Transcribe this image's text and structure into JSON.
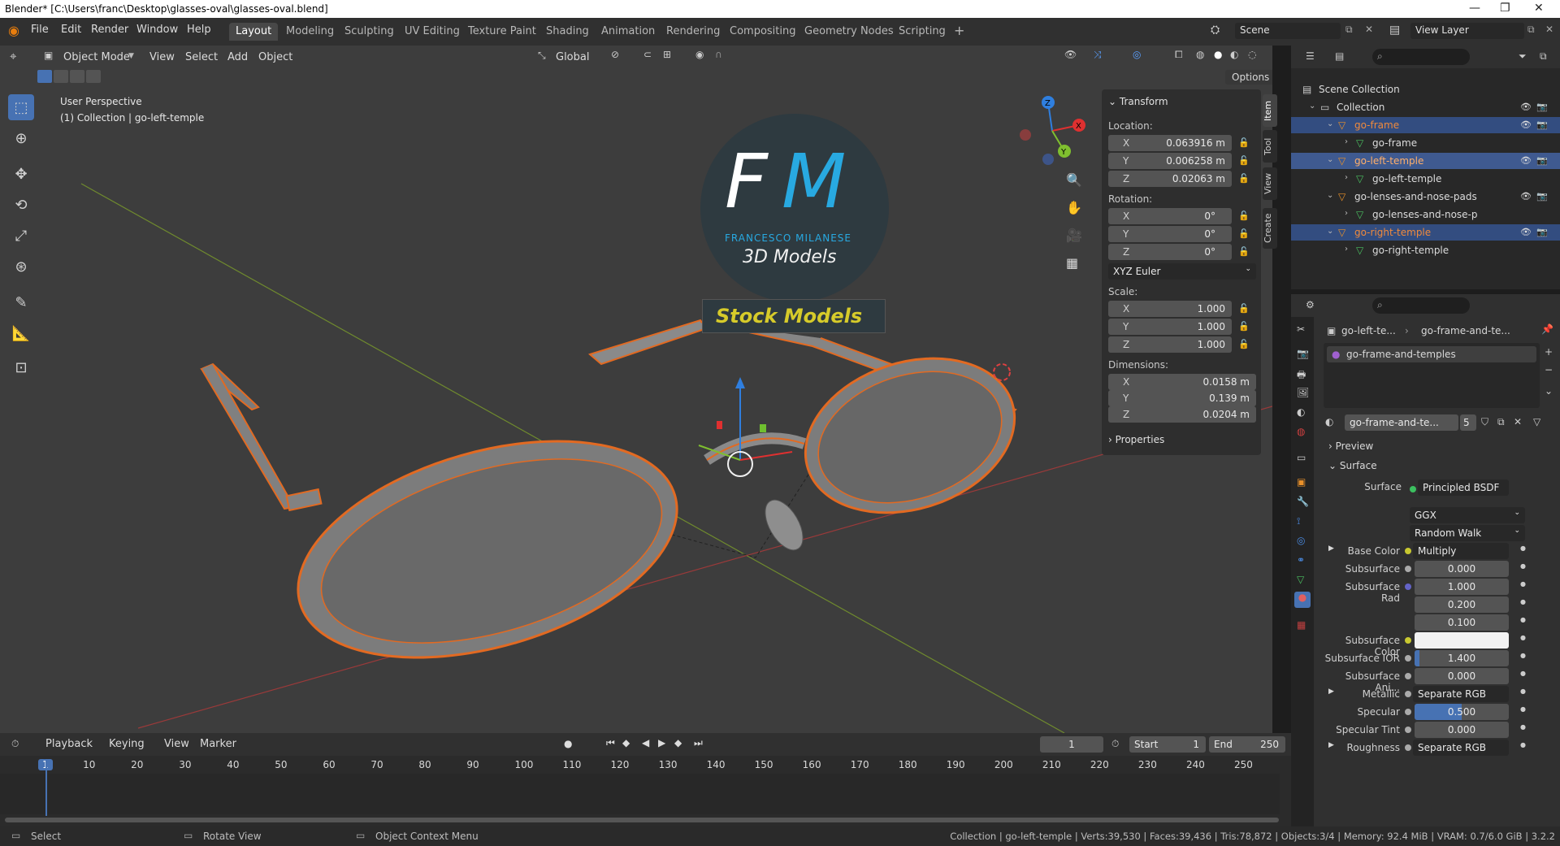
{
  "window": {
    "title": "Blender* [C:\\Users\\franc\\Desktop\\glasses-oval\\glasses-oval.blend]",
    "controls": [
      "—",
      "❐",
      "✕"
    ]
  },
  "menu": [
    "File",
    "Edit",
    "Render",
    "Window",
    "Help"
  ],
  "workspaces": [
    "Layout",
    "Modeling",
    "Sculpting",
    "UV Editing",
    "Texture Paint",
    "Shading",
    "Animation",
    "Rendering",
    "Compositing",
    "Geometry Nodes",
    "Scripting",
    "+"
  ],
  "scene": {
    "label": "Scene",
    "view_layer": "View Layer"
  },
  "viewport": {
    "mode": "Object Mode",
    "menus": [
      "View",
      "Select",
      "Add",
      "Object"
    ],
    "orientation": "Global",
    "options": "Options",
    "info_line1": "User Perspective",
    "info_line2": "(1) Collection | go-left-temple",
    "logo_initials_f": "F",
    "logo_initials_m": "M",
    "logo_name": "FRANCESCO MILANESE",
    "logo_sub": "3D Models",
    "banner": "Stock Models"
  },
  "gizmo": {
    "x": "X",
    "y": "Y",
    "z": "Z"
  },
  "npanel": {
    "section": "Transform",
    "location_label": "Location:",
    "location": [
      {
        "axis": "X",
        "value": "0.063916 m"
      },
      {
        "axis": "Y",
        "value": "0.006258 m"
      },
      {
        "axis": "Z",
        "value": "0.02063 m"
      }
    ],
    "rotation_label": "Rotation:",
    "rotation": [
      {
        "axis": "X",
        "value": "0°"
      },
      {
        "axis": "Y",
        "value": "0°"
      },
      {
        "axis": "Z",
        "value": "0°"
      }
    ],
    "rotation_mode": "XYZ Euler",
    "scale_label": "Scale:",
    "scale": [
      {
        "axis": "X",
        "value": "1.000"
      },
      {
        "axis": "Y",
        "value": "1.000"
      },
      {
        "axis": "Z",
        "value": "1.000"
      }
    ],
    "dimensions_label": "Dimensions:",
    "dimensions": [
      {
        "axis": "X",
        "value": "0.0158 m"
      },
      {
        "axis": "Y",
        "value": "0.139 m"
      },
      {
        "axis": "Z",
        "value": "0.0204 m"
      }
    ],
    "properties": "Properties",
    "tabs": [
      "Item",
      "Tool",
      "View",
      "Create"
    ]
  },
  "outliner": {
    "rows": [
      {
        "name": "Scene Collection",
        "indent": 0,
        "sel": false
      },
      {
        "name": "Collection",
        "indent": 1,
        "sel": false
      },
      {
        "name": "go-frame",
        "indent": 2,
        "sel": true,
        "orange": true
      },
      {
        "name": "go-frame",
        "indent": 3,
        "sel": false
      },
      {
        "name": "go-left-temple",
        "indent": 2,
        "sel": true,
        "active": true
      },
      {
        "name": "go-left-temple",
        "indent": 3,
        "sel": false
      },
      {
        "name": "go-lenses-and-nose-pads",
        "indent": 2,
        "sel": false
      },
      {
        "name": "go-lenses-and-nose-p",
        "indent": 3,
        "sel": false
      },
      {
        "name": "go-right-temple",
        "indent": 2,
        "sel": true,
        "orange": true
      },
      {
        "name": "go-right-temple",
        "indent": 3,
        "sel": false
      }
    ]
  },
  "properties": {
    "breadcrumb_obj": "go-left-te...",
    "breadcrumb_mat": "go-frame-and-te...",
    "slot": "go-frame-and-temples",
    "material_name": "go-frame-and-te...",
    "users": "5",
    "preview": "Preview",
    "surface_section": "Surface",
    "surface_label": "Surface",
    "surface_value": "Principled BSDF",
    "distribution": "GGX",
    "subsurface_method": "Random Walk",
    "rows": [
      {
        "label": "Base Color",
        "value": "Multiply",
        "dot": "#c8c830",
        "dark": true,
        "arrow": true
      },
      {
        "label": "Subsurface",
        "value": "0.000",
        "dot": "#aaaaaa"
      },
      {
        "label": "Subsurface Rad",
        "value": "1.000",
        "dot": "#6363c7"
      },
      {
        "label": "",
        "value": "0.200"
      },
      {
        "label": "",
        "value": "0.100"
      },
      {
        "label": "Subsurface Color",
        "value": "",
        "dot": "#c8c830",
        "white": true
      },
      {
        "label": "Subsurface IOR",
        "value": "1.400",
        "dot": "#aaaaaa",
        "fill": 0.05
      },
      {
        "label": "Subsurface Ani...",
        "value": "0.000",
        "dot": "#aaaaaa"
      },
      {
        "label": "Metallic",
        "value": "Separate RGB",
        "dot": "#aaaaaa",
        "dark": true,
        "arrow": true
      },
      {
        "label": "Specular",
        "value": "0.500",
        "dot": "#aaaaaa",
        "fill": 0.5
      },
      {
        "label": "Specular Tint",
        "value": "0.000",
        "dot": "#aaaaaa"
      },
      {
        "label": "Roughness",
        "value": "Separate RGB",
        "dot": "#aaaaaa",
        "dark": true,
        "arrow": true
      }
    ]
  },
  "timeline": {
    "menus": [
      "Playback",
      "Keying",
      "View",
      "Marker"
    ],
    "current_frame": "1",
    "start_label": "Start",
    "start": "1",
    "end_label": "End",
    "end": "250",
    "ticks": [
      "1",
      "10",
      "20",
      "30",
      "40",
      "50",
      "60",
      "70",
      "80",
      "90",
      "100",
      "110",
      "120",
      "130",
      "140",
      "150",
      "160",
      "170",
      "180",
      "190",
      "200",
      "210",
      "220",
      "230",
      "240",
      "250"
    ]
  },
  "status": {
    "select": "Select",
    "rotate": "Rotate View",
    "context": "Object Context Menu",
    "stats": "Collection | go-left-temple | Verts:39,530 | Faces:39,436 | Tris:78,872 | Objects:3/4 | Memory: 92.4 MiB | VRAM: 0.7/6.0 GiB | 3.2.2"
  }
}
